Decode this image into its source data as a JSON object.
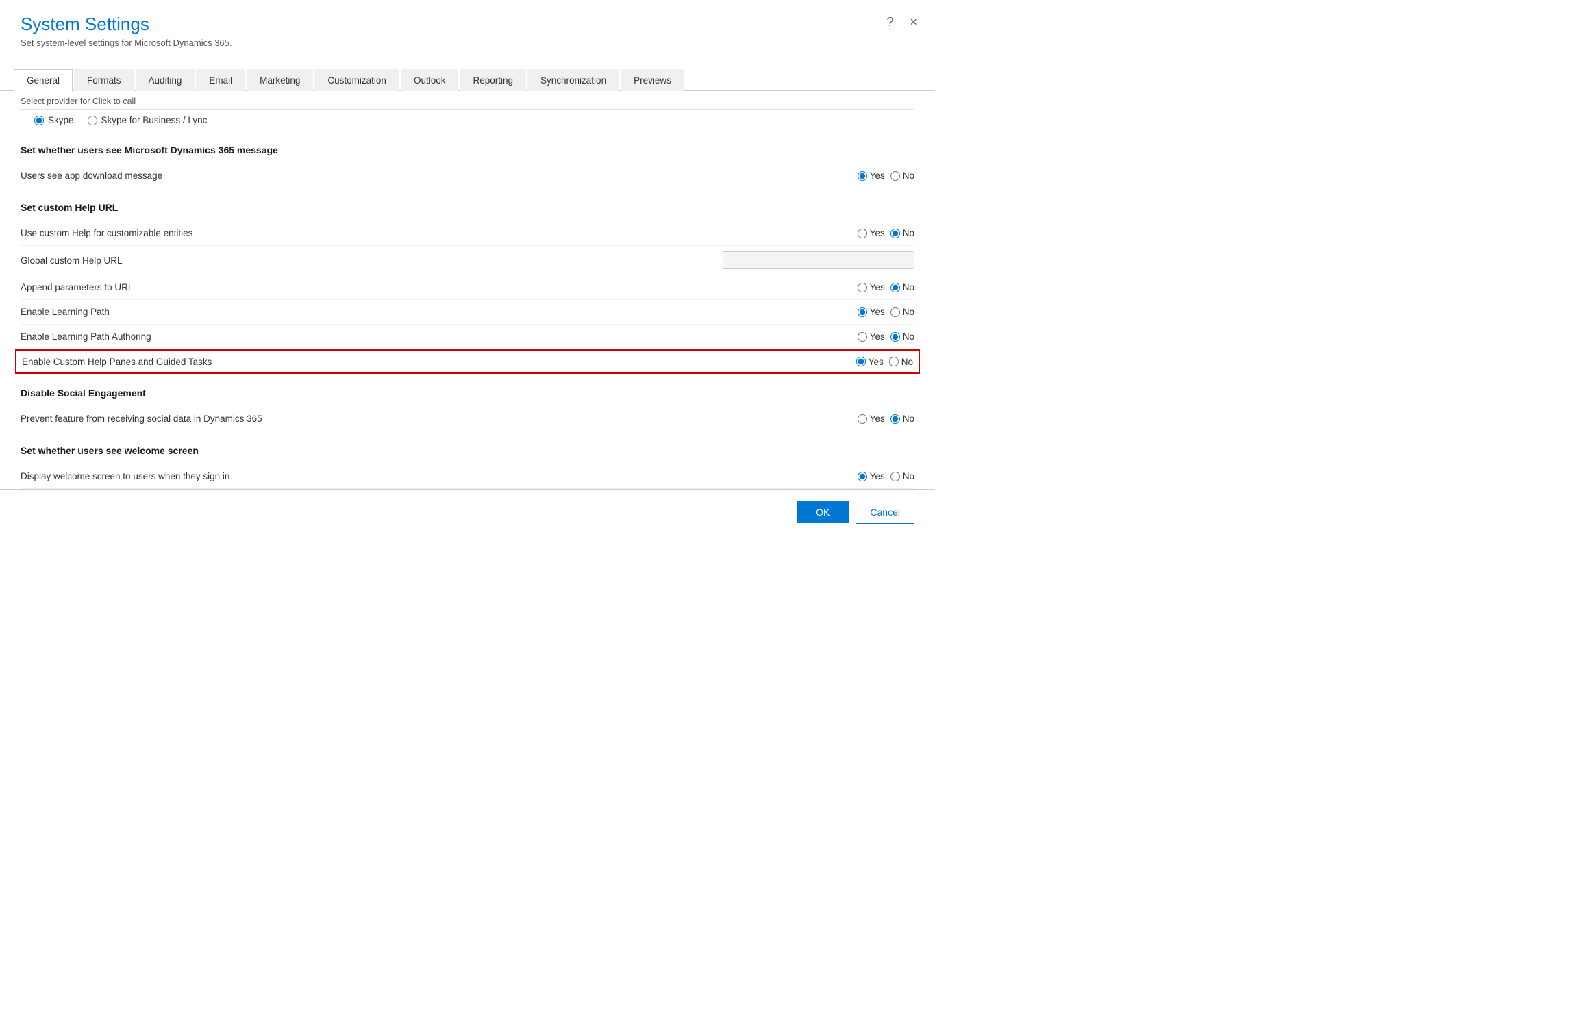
{
  "dialog": {
    "title": "System Settings",
    "subtitle": "Set system-level settings for Microsoft Dynamics 365.",
    "close_label": "×",
    "help_label": "?"
  },
  "tabs": [
    {
      "id": "general",
      "label": "General",
      "active": true
    },
    {
      "id": "formats",
      "label": "Formats",
      "active": false
    },
    {
      "id": "auditing",
      "label": "Auditing",
      "active": false
    },
    {
      "id": "email",
      "label": "Email",
      "active": false
    },
    {
      "id": "marketing",
      "label": "Marketing",
      "active": false
    },
    {
      "id": "customization",
      "label": "Customization",
      "active": false
    },
    {
      "id": "outlook",
      "label": "Outlook",
      "active": false
    },
    {
      "id": "reporting",
      "label": "Reporting",
      "active": false
    },
    {
      "id": "synchronization",
      "label": "Synchronization",
      "active": false
    },
    {
      "id": "previews",
      "label": "Previews",
      "active": false
    }
  ],
  "scroll_hint": "Select provider for Click to call",
  "click_to_call": {
    "options": [
      {
        "id": "skype",
        "label": "Skype",
        "checked": true
      },
      {
        "id": "skype_business",
        "label": "Skype for Business / Lync",
        "checked": false
      }
    ]
  },
  "sections": [
    {
      "id": "ms_message",
      "heading": "Set whether users see Microsoft Dynamics 365 message",
      "rows": [
        {
          "id": "app_download",
          "label": "Users see app download message",
          "yes_checked": true,
          "no_checked": false,
          "has_text_input": false,
          "highlighted": false
        }
      ]
    },
    {
      "id": "custom_help",
      "heading": "Set custom Help URL",
      "rows": [
        {
          "id": "use_custom_help",
          "label": "Use custom Help for customizable entities",
          "yes_checked": false,
          "no_checked": true,
          "has_text_input": false,
          "highlighted": false
        },
        {
          "id": "global_custom_help_url",
          "label": "Global custom Help URL",
          "yes_checked": false,
          "no_checked": false,
          "has_text_input": true,
          "highlighted": false
        },
        {
          "id": "append_params",
          "label": "Append parameters to URL",
          "yes_checked": false,
          "no_checked": true,
          "has_text_input": false,
          "highlighted": false
        },
        {
          "id": "enable_learning_path",
          "label": "Enable Learning Path",
          "yes_checked": true,
          "no_checked": false,
          "has_text_input": false,
          "highlighted": false
        },
        {
          "id": "enable_learning_path_authoring",
          "label": "Enable Learning Path Authoring",
          "yes_checked": false,
          "no_checked": true,
          "has_text_input": false,
          "highlighted": false
        },
        {
          "id": "enable_custom_help_panes",
          "label": "Enable Custom Help Panes and Guided Tasks",
          "yes_checked": true,
          "no_checked": false,
          "has_text_input": false,
          "highlighted": true
        }
      ]
    },
    {
      "id": "social_engagement",
      "heading": "Disable Social Engagement",
      "rows": [
        {
          "id": "prevent_social",
          "label": "Prevent feature from receiving social data in Dynamics 365",
          "yes_checked": false,
          "no_checked": true,
          "has_text_input": false,
          "highlighted": false
        }
      ]
    },
    {
      "id": "welcome_screen",
      "heading": "Set whether users see welcome screen",
      "rows": [
        {
          "id": "display_welcome",
          "label": "Display welcome screen to users when they sign in",
          "yes_checked": true,
          "no_checked": false,
          "has_text_input": false,
          "highlighted": false
        }
      ]
    }
  ],
  "footer": {
    "ok_label": "OK",
    "cancel_label": "Cancel"
  }
}
